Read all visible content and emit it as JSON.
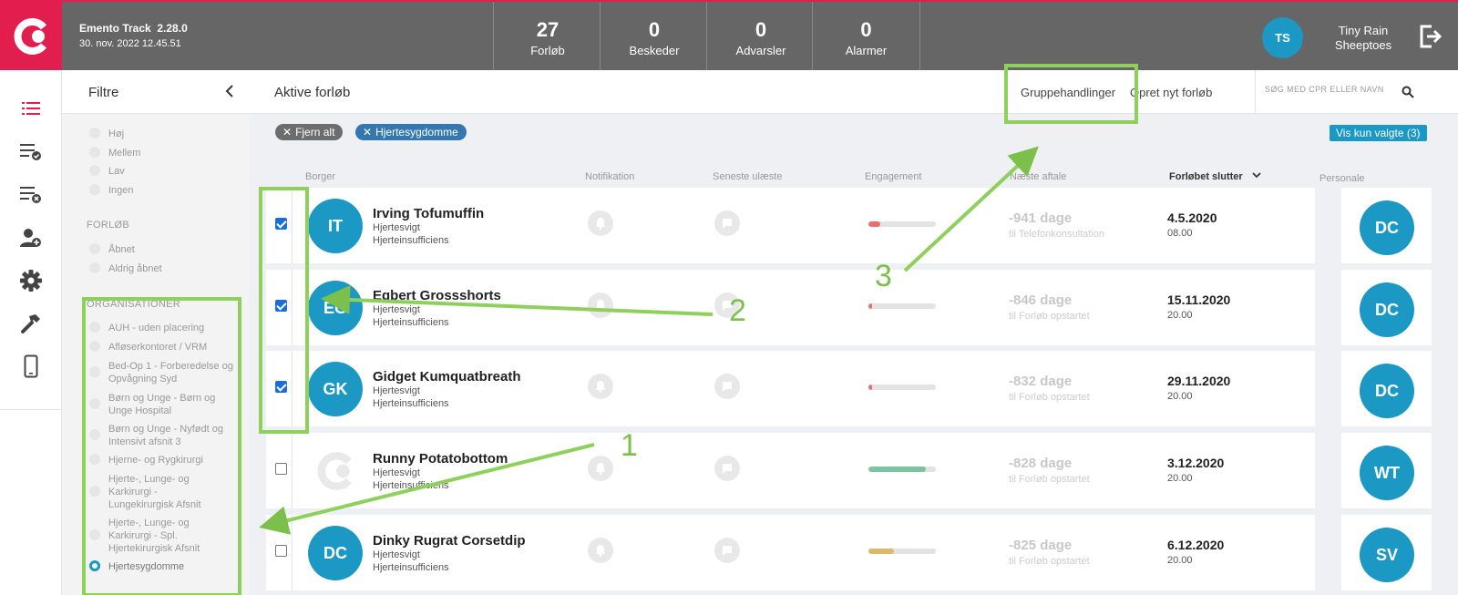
{
  "app": {
    "name": "Emento Track",
    "version": "2.28.0",
    "datetime": "30. nov. 2022 12.45.51"
  },
  "stats": [
    {
      "value": "27",
      "label": "Forløb"
    },
    {
      "value": "0",
      "label": "Beskeder"
    },
    {
      "value": "0",
      "label": "Advarsler"
    },
    {
      "value": "0",
      "label": "Alarmer"
    }
  ],
  "user": {
    "initials": "TS",
    "name_line1": "Tiny Rain",
    "name_line2": "Sheeptoes"
  },
  "filters": {
    "title": "Filtre",
    "priority_options": [
      "Høj",
      "Mellem",
      "Lav",
      "Ingen"
    ],
    "forloeb_title": "FORLØB",
    "forloeb_options": [
      "Åbnet",
      "Aldrig åbnet"
    ],
    "org_title": "ORGANISATIONER",
    "org_options": [
      "AUH - uden placering",
      "Afløserkontoret / VRM",
      "Bed-Op 1 - Forberedelse og Opvågning Syd",
      "Børn og Unge - Børn og Unge Hospital",
      "Børn og Unge - Nyfødt og Intensivt afsnit 3",
      "Hjerne- og Rygkirurgi",
      "Hjerte-, Lunge- og Karkirurgi - Lungekirurgisk Afsnit",
      "Hjerte-, Lunge- og Karkirurgi - Spl. Hjertekirurgisk Afsnit",
      "Hjertesygdomme"
    ]
  },
  "main": {
    "title": "Aktive forløb",
    "group_actions": "Gruppehandlinger",
    "new_course": "Opret nyt forløb",
    "search_placeholder": "SØG MED CPR ELLER NAVN",
    "chip_remove_all": "Fjern alt",
    "chip_filter": "Hjertesygdomme",
    "show_selected": "Vis kun valgte (3)",
    "columns": {
      "citizen": "Borger",
      "notification": "Notifikation",
      "latest_unread": "Seneste ulæste",
      "engagement": "Engagement",
      "next_appointment": "Næste aftale",
      "ends": "Forløbet slutter",
      "staff": "Personale"
    }
  },
  "rows": [
    {
      "initials": "IT",
      "name": "Irving Tofumuffin",
      "line1": "Hjertesvigt",
      "line2": "Hjerteinsufficiens",
      "checked": true,
      "engagement": 0.18,
      "eng_color": "#e8706f",
      "next_days": "-941 dage",
      "next_sub": "til Telefonkonsultation",
      "end_date": "4.5.2020",
      "end_time": "08.00",
      "staff": "DC"
    },
    {
      "initials": "EG",
      "name": "Egbert Grossshorts",
      "line1": "Hjertesvigt",
      "line2": "Hjerteinsufficiens",
      "checked": true,
      "engagement": 0.06,
      "eng_color": "#e8706f",
      "next_days": "-846 dage",
      "next_sub": "til Forløb opstartet",
      "end_date": "15.11.2020",
      "end_time": "20.00",
      "staff": "DC"
    },
    {
      "initials": "GK",
      "name": "Gidget Kumquatbreath",
      "line1": "Hjertesvigt",
      "line2": "Hjerteinsufficiens",
      "checked": true,
      "engagement": 0.06,
      "eng_color": "#e8706f",
      "next_days": "-832 dage",
      "next_sub": "til Forløb opstartet",
      "end_date": "29.11.2020",
      "end_time": "20.00",
      "staff": "DC"
    },
    {
      "initials": "",
      "name": "Runny Potatobottom",
      "line1": "Hjertesvigt",
      "line2": "Hjerteinsufficiens",
      "checked": false,
      "engagement": 0.85,
      "eng_color": "#7dc4a0",
      "next_days": "-828 dage",
      "next_sub": "til Forløb opstartet",
      "end_date": "3.12.2020",
      "end_time": "20.00",
      "staff": "WT"
    },
    {
      "initials": "DC",
      "name": "Dinky Rugrat Corsetdip",
      "line1": "Hjertesvigt",
      "line2": "Hjerteinsufficiens",
      "checked": false,
      "engagement": 0.38,
      "eng_color": "#e0b86a",
      "next_days": "-825 dage",
      "next_sub": "til Forløb opstartet",
      "end_date": "6.12.2020",
      "end_time": "20.00",
      "staff": "SV"
    }
  ],
  "annotations": [
    "1",
    "2",
    "3"
  ],
  "colors": {
    "brand": "#e21e4f",
    "accent": "#1b98c4",
    "annotation": "#7cc04b",
    "topbar": "#666666"
  }
}
